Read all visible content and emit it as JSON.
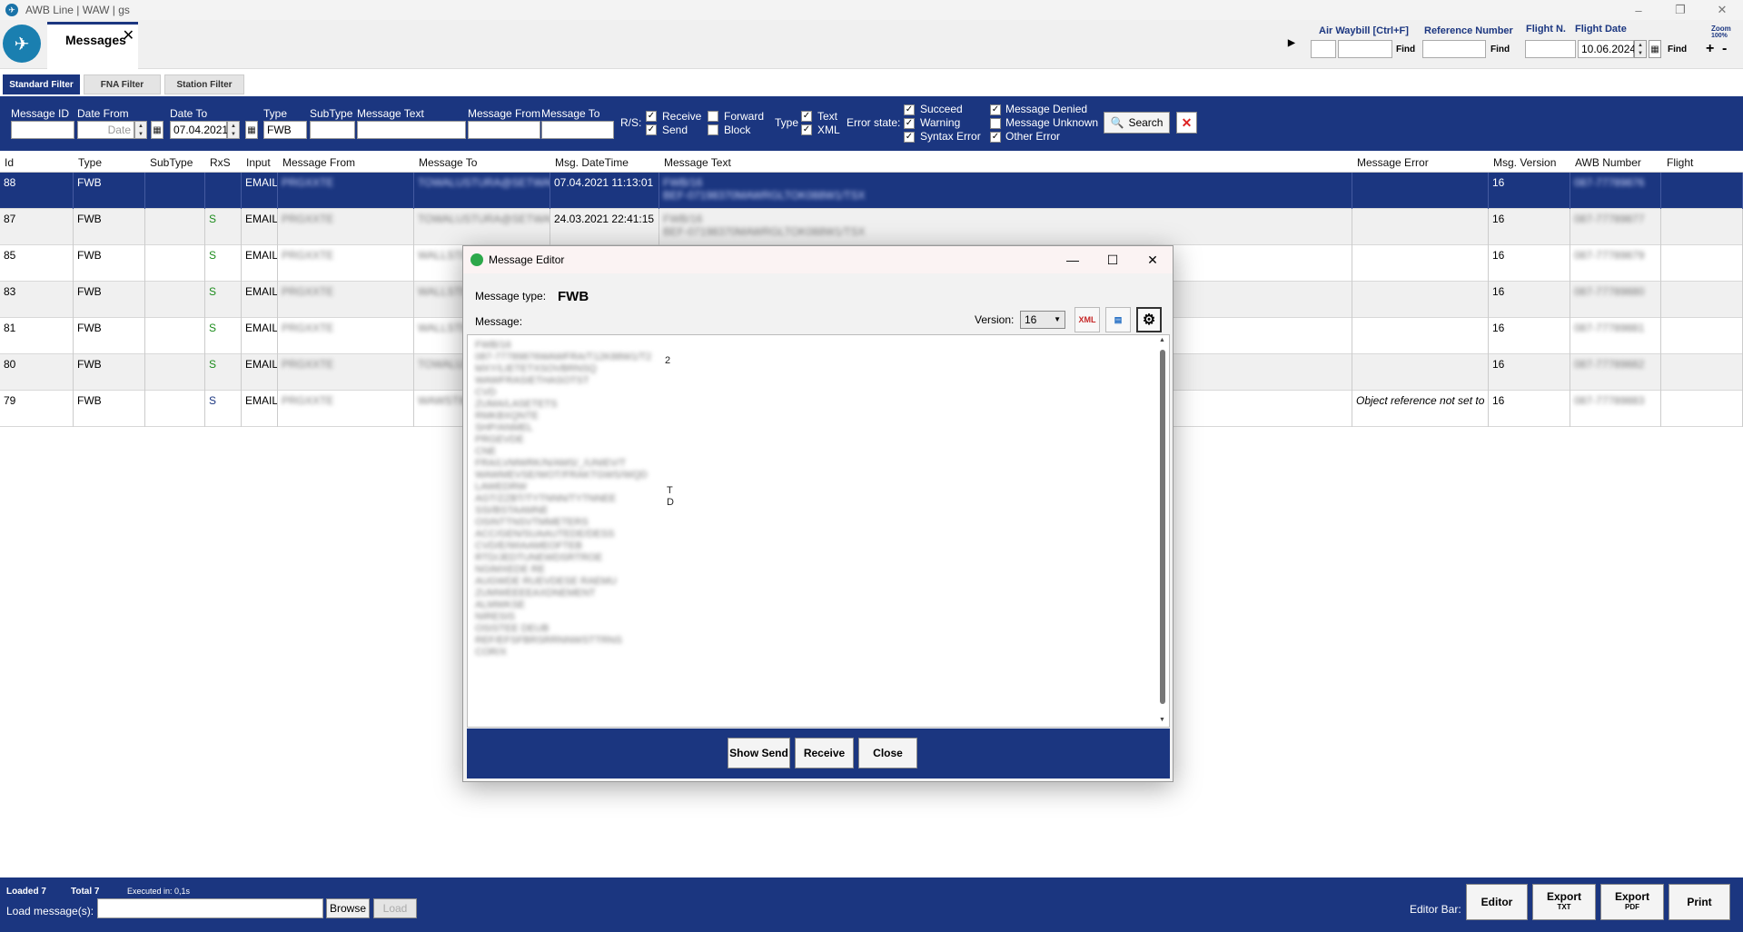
{
  "window": {
    "title": "AWB Line | WAW | gs",
    "controls": [
      "–",
      "❐",
      "✕"
    ]
  },
  "tab": {
    "label": "Messages",
    "close": "✕"
  },
  "quicksearch": {
    "awb_label": "Air Waybill [Ctrl+F]",
    "ref_label": "Reference Number",
    "flight_label": "Flight N.",
    "date_label": "Flight Date",
    "date_value": "10.06.2024",
    "find": "Find",
    "zoom": "Zoom",
    "zoom_level": "100%",
    "zoom_in": "+",
    "zoom_out": "-",
    "expand": "▶"
  },
  "filter_tabs": [
    "Standard Filter",
    "FNA Filter",
    "Station Filter"
  ],
  "filter": {
    "message_id": "Message ID",
    "date_from": "Date From",
    "date_from_placeholder": "Date",
    "date_to": "Date To",
    "date_to_value": "07.04.2021",
    "type": "Type",
    "type_value": "FWB",
    "subtype": "SubType",
    "message_text": "Message Text",
    "message_from": "Message From",
    "message_to": "Message To",
    "rs": "R/S:",
    "receive": "Receive",
    "send": "Send",
    "forward": "Forward",
    "block": "Block",
    "type2": "Type",
    "text": "Text",
    "xml": "XML",
    "error_state": "Error state:",
    "succeed": "Succeed",
    "warning": "Warning",
    "syntax_error": "Syntax Error",
    "message_denied": "Message Denied",
    "message_unknown": "Message Unknown",
    "other_error": "Other Error",
    "search": "Search",
    "check": "✓"
  },
  "table": {
    "headers": [
      "Id",
      "Type",
      "SubType",
      "RxS",
      "Input",
      "Message From",
      "Message To",
      "Msg. DateTime",
      "Message Text",
      "Message Error",
      "Msg. Version",
      "AWB Number",
      "Flight"
    ],
    "rows": [
      {
        "id": "88",
        "type": "FWB",
        "rxs": "",
        "input": "EMAIL",
        "from": "PRGXXTE",
        "to": "TOWALUSTURA@SETWARS",
        "dt": "07.04.2021 11:13:01",
        "text": "FWB/16",
        "text2": "BEF-07198370MAWRGLTOK088W1/TSX",
        "err": "",
        "ver": "16",
        "awb": "087-77789876"
      },
      {
        "id": "87",
        "type": "FWB",
        "rxs": "S",
        "input": "EMAIL",
        "from": "PRGXXTE",
        "to": "TOWALUSTURA@SETWARS",
        "dt": "24.03.2021 22:41:15",
        "text": "FWB/16",
        "text2": "BEF-07198370MAWRGLTOK088W1/TSX",
        "err": "",
        "ver": "16",
        "awb": "087-77789877"
      },
      {
        "id": "85",
        "type": "FWB",
        "rxs": "S",
        "input": "EMAIL",
        "from": "PRGXXTE",
        "to": "WALLSTEE",
        "dt": "",
        "text": "",
        "text2": "",
        "err": "",
        "ver": "16",
        "awb": "087-77789879"
      },
      {
        "id": "83",
        "type": "FWB",
        "rxs": "S",
        "input": "EMAIL",
        "from": "PRGXXTE",
        "to": "WALLSTEE",
        "dt": "",
        "text": "",
        "text2": "",
        "err": "",
        "ver": "16",
        "awb": "087-77789880"
      },
      {
        "id": "81",
        "type": "FWB",
        "rxs": "S",
        "input": "EMAIL",
        "from": "PRGXXTE",
        "to": "WALLSTEE",
        "dt": "",
        "text": "",
        "text2": "",
        "err": "",
        "ver": "16",
        "awb": "087-77789881"
      },
      {
        "id": "80",
        "type": "FWB",
        "rxs": "S",
        "input": "EMAIL",
        "from": "PRGXXTE",
        "to": "TOWALUST",
        "dt": "",
        "text": "",
        "text2": "",
        "err": "",
        "ver": "16",
        "awb": "087-77789882"
      },
      {
        "id": "79",
        "type": "FWB",
        "rxs": "S",
        "input": "EMAIL",
        "from": "PRGXXTE",
        "to": "WAWSTIE",
        "dt": "",
        "text": "",
        "text2": "",
        "err": "Object reference not set to",
        "ver": "16",
        "awb": "087-77789883"
      }
    ]
  },
  "dialog": {
    "title": "Message Editor",
    "type_label": "Message type:",
    "type_value": "FWB",
    "message_label": "Message:",
    "version_label": "Version:",
    "version_value": "16",
    "xml_icon": "XML",
    "lines": [
      "FWB/16",
      "087-77789876WAWFRA/T12K88W1/T2",
      "MXY/LIETETXSOVBRNSQ",
      "WAWFRASIETHASOTST",
      "CVD",
      "ZUMA/LASETETS",
      "RMKBXQNTE",
      "SHP/ANMEL",
      "PRGEVDE",
      "CNE",
      "FRA/LVMWRK/N/AMS/_/UNIEV/T",
      "WAWMEVSE/WOT/FRAKTGWS/WQD",
      "LAWEDRW",
      "AGT/ZZBT/TYTNNN/TYTNNEE",
      "SSI/BSTAAMNE",
      "OSINTTNSVTMMETERS",
      "ACC/GEN/SUAAUTEDE/DESS",
      "CVD/E/WIAAMEOFTEB",
      "RTD/JEDTUNEWDSRTROE",
      "NGIMXEDE RE",
      "AUGWDE RUEVDESE RAEMU",
      "ZUMWEEEEAXDNEMENT",
      "ALMWKSE",
      "NIRESIS",
      "OSISTEE DEUB",
      "REF/EFSFBRSRRNNWSTTRNS",
      "COR/X"
    ],
    "tail1": "2",
    "tail2": "T",
    "tail3": "D",
    "buttons": {
      "show_send": "Show Send",
      "receive": "Receive",
      "close": "Close"
    }
  },
  "bottom": {
    "loaded": "Loaded 7",
    "total": "Total 7",
    "executed": "Executed in: 0,1s",
    "load_label": "Load message(s):",
    "browse": "Browse",
    "load": "Load",
    "editor_bar": "Editor Bar:",
    "editor": "Editor",
    "export_txt": "Export",
    "export_txt_sub": "TXT",
    "export_pdf": "Export",
    "export_pdf_sub": "PDF",
    "print": "Print"
  }
}
